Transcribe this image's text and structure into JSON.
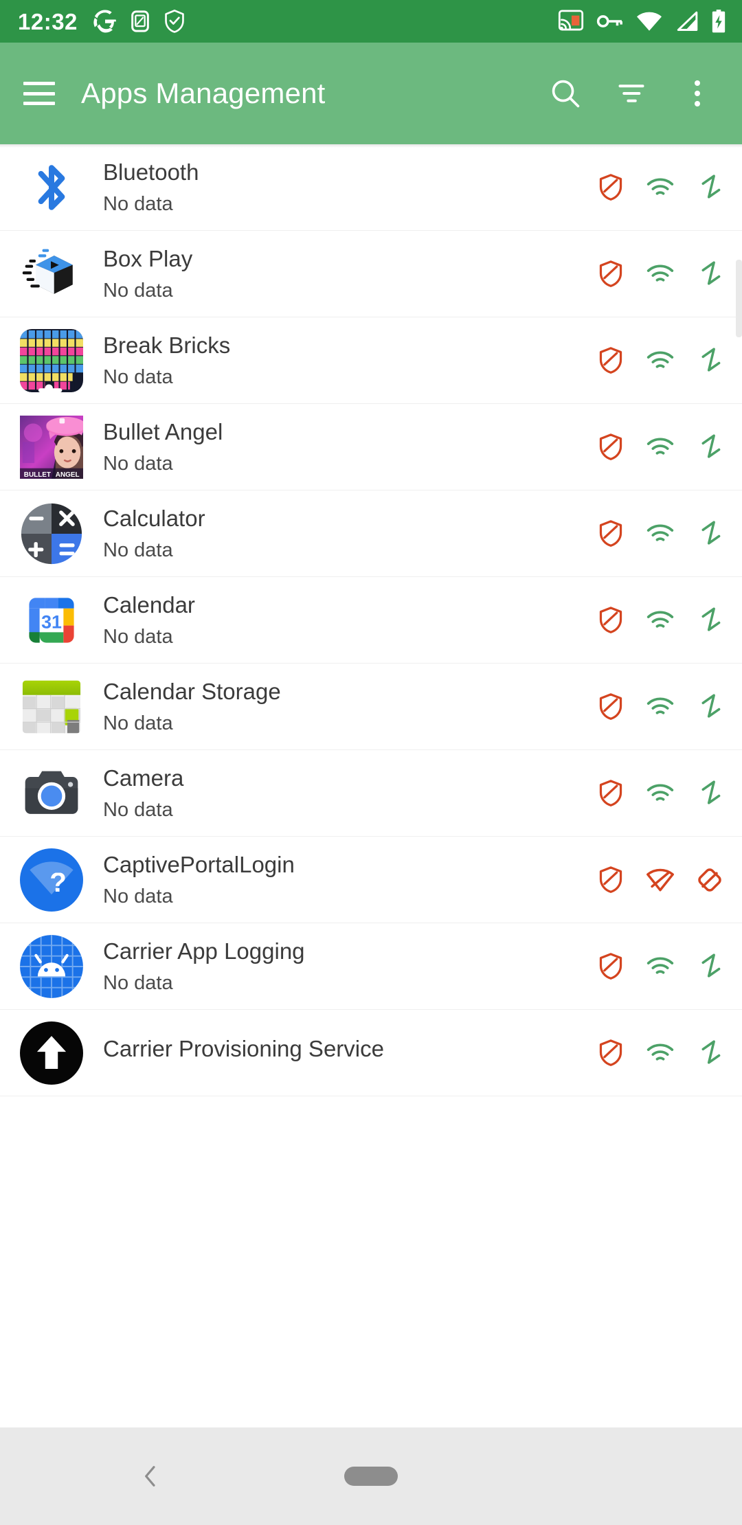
{
  "status_bar": {
    "time": "12:32",
    "left_icons": [
      "google-g-icon",
      "screenshot-edit-icon",
      "shield-check-icon"
    ],
    "right_icons": [
      "cast-icon",
      "vpn-key-icon",
      "wifi-icon",
      "mobile-signal-icon",
      "battery-charging-icon"
    ],
    "background_color": "#2E9447"
  },
  "app_bar": {
    "title": "Apps Management",
    "menu_icon": "hamburger-menu-icon",
    "actions": [
      {
        "name": "search-icon",
        "label": "Search"
      },
      {
        "name": "sort-filter-icon",
        "label": "Sort"
      },
      {
        "name": "overflow-menu-icon",
        "label": "More options"
      }
    ],
    "background_color": "#6CB97F",
    "text_color": "#FFFFFF"
  },
  "colors": {
    "status_blocked": "#D4441F",
    "status_allowed": "#4CA167",
    "accent_green": "#6CB97F",
    "status_bar_green": "#2E9447",
    "row_divider": "#EFEFEF",
    "nav_bar": "#E9E9E9"
  },
  "list": {
    "subtitle_default": "No data",
    "rows": [
      {
        "name": "Bluetooth",
        "subtitle": "No data",
        "icon": "bluetooth-icon",
        "status": [
          "shield-blocked",
          "wifi-allowed",
          "activity-allowed"
        ]
      },
      {
        "name": "Box Play",
        "subtitle": "No data",
        "icon": "box-play-icon",
        "status": [
          "shield-blocked",
          "wifi-allowed",
          "activity-allowed"
        ]
      },
      {
        "name": "Break Bricks",
        "subtitle": "No data",
        "icon": "break-bricks-icon",
        "status": [
          "shield-blocked",
          "wifi-allowed",
          "activity-allowed"
        ]
      },
      {
        "name": "Bullet Angel",
        "subtitle": "No data",
        "icon": "bullet-angel-icon",
        "status": [
          "shield-blocked",
          "wifi-allowed",
          "activity-allowed"
        ]
      },
      {
        "name": "Calculator",
        "subtitle": "No data",
        "icon": "calculator-icon",
        "status": [
          "shield-blocked",
          "wifi-allowed",
          "activity-allowed"
        ]
      },
      {
        "name": "Calendar",
        "subtitle": "No data",
        "icon": "google-calendar-icon",
        "status": [
          "shield-blocked",
          "wifi-allowed",
          "activity-allowed"
        ]
      },
      {
        "name": "Calendar Storage",
        "subtitle": "No data",
        "icon": "calendar-storage-icon",
        "status": [
          "shield-blocked",
          "wifi-allowed",
          "activity-allowed"
        ]
      },
      {
        "name": "Camera",
        "subtitle": "No data",
        "icon": "camera-icon",
        "status": [
          "shield-blocked",
          "wifi-allowed",
          "activity-allowed"
        ]
      },
      {
        "name": "CaptivePortalLogin",
        "subtitle": "No data",
        "icon": "captive-portal-login-icon",
        "status": [
          "shield-blocked",
          "wifi-blocked",
          "activity-blocked"
        ]
      },
      {
        "name": "Carrier App Logging",
        "subtitle": "No data",
        "icon": "carrier-app-logging-icon",
        "status": [
          "shield-blocked",
          "wifi-allowed",
          "activity-allowed"
        ]
      },
      {
        "name": "Carrier Provisioning Service",
        "subtitle": "",
        "icon": "carrier-provisioning-icon",
        "status": [
          "shield-blocked",
          "wifi-allowed",
          "activity-allowed"
        ]
      }
    ]
  },
  "nav_bar": {
    "back_icon": "back-chevron-icon",
    "home_pill": "home-gesture-pill"
  }
}
